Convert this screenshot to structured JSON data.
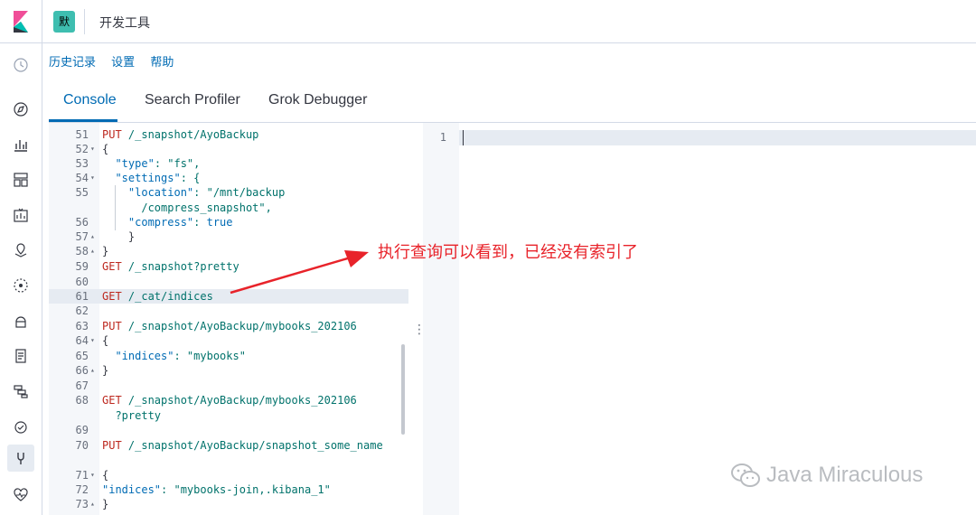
{
  "header": {
    "app_badge": "默",
    "title": "开发工具"
  },
  "menu": {
    "history": "历史记录",
    "settings": "设置",
    "help": "帮助"
  },
  "tabs": [
    {
      "label": "Console",
      "active": true
    },
    {
      "label": "Search Profiler",
      "active": false
    },
    {
      "label": "Grok Debugger",
      "active": false
    }
  ],
  "editor": {
    "lines": [
      {
        "num": "51",
        "fold": "",
        "text": "PUT /_snapshot/AyoBackup"
      },
      {
        "num": "52",
        "fold": "▾",
        "text": "{"
      },
      {
        "num": "53",
        "fold": "",
        "text": "  \"type\": \"fs\","
      },
      {
        "num": "54",
        "fold": "▾",
        "text": "  \"settings\": {"
      },
      {
        "num": "55",
        "fold": "",
        "text": "    \"location\": \"/mnt/backup"
      },
      {
        "num": "",
        "fold": "",
        "text": "      /compress_snapshot\","
      },
      {
        "num": "56",
        "fold": "",
        "text": "    \"compress\": true"
      },
      {
        "num": "57",
        "fold": "▴",
        "text": "    }"
      },
      {
        "num": "58",
        "fold": "▴",
        "text": "}"
      },
      {
        "num": "59",
        "fold": "",
        "text": "GET /_snapshot?pretty"
      },
      {
        "num": "60",
        "fold": "",
        "text": ""
      },
      {
        "num": "61",
        "fold": "",
        "text": "GET /_cat/indices"
      },
      {
        "num": "62",
        "fold": "",
        "text": ""
      },
      {
        "num": "63",
        "fold": "",
        "text": "PUT /_snapshot/AyoBackup/mybooks_202106"
      },
      {
        "num": "64",
        "fold": "▾",
        "text": "{"
      },
      {
        "num": "65",
        "fold": "",
        "text": "  \"indices\": \"mybooks\""
      },
      {
        "num": "66",
        "fold": "▴",
        "text": "}"
      },
      {
        "num": "67",
        "fold": "",
        "text": ""
      },
      {
        "num": "68",
        "fold": "",
        "text": "GET /_snapshot/AyoBackup/mybooks_202106"
      },
      {
        "num": "",
        "fold": "",
        "text": "  ?pretty"
      },
      {
        "num": "69",
        "fold": "",
        "text": ""
      },
      {
        "num": "70",
        "fold": "",
        "text": "PUT /_snapshot/AyoBackup/snapshot_some_name"
      },
      {
        "num": "",
        "fold": "",
        "text": ""
      },
      {
        "num": "71",
        "fold": "▾",
        "text": "{"
      },
      {
        "num": "72",
        "fold": "",
        "text": "\"indices\": \"mybooks-join,.kibana_1\""
      },
      {
        "num": "73",
        "fold": "▴",
        "text": "}"
      }
    ]
  },
  "output": {
    "line_number": "1"
  },
  "annotation": {
    "text": "执行查询可以看到，已经没有索引了",
    "color": "#e8232a"
  },
  "watermark": {
    "text": "Java Miraculous"
  },
  "colors": {
    "accent": "#006bb4",
    "badge": "#3ebeb0",
    "method": "#bd271e",
    "string": "#00726b"
  }
}
